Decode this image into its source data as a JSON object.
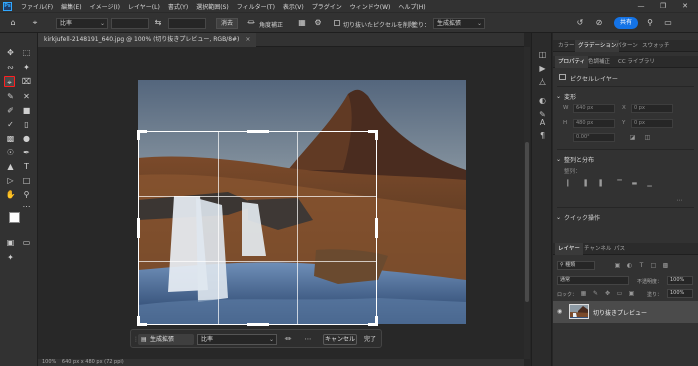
{
  "app": {
    "logo": "Ps"
  },
  "menubar": {
    "items": [
      "ファイル(F)",
      "編集(E)",
      "イメージ(I)",
      "レイヤー(L)",
      "書式(Y)",
      "選択範囲(S)",
      "フィルター(T)",
      "表示(V)",
      "プラグイン",
      "ウィンドウ(W)",
      "ヘルプ(H)"
    ],
    "window_controls": [
      "minimize-icon",
      "restore-icon",
      "close-icon"
    ]
  },
  "options_bar": {
    "ratio_select": "比率",
    "clear_button": "消去",
    "straighten_label": "角度補正",
    "delete_cropped_label": "切り抜いたピクセルを削除",
    "fill_label": "塗り：",
    "fill_select": "生成拡張",
    "share_button": "共有"
  },
  "document": {
    "tab_title": "kirkjufell-2148191_640.jpg @ 100% (切り抜きプレビュー, RGB/8#)",
    "tab_close": "×"
  },
  "statusbar": {
    "zoom": "100%",
    "size": "640 px x 480 px (72 ppi)"
  },
  "taskbar": {
    "generative_expand": "生成拡張",
    "ratio": "比率",
    "cancel": "キャンセル",
    "done": "完了"
  },
  "right_panel": {
    "top_tabs": [
      "カラー",
      "グラデーション",
      "パターン",
      "スウォッチ"
    ],
    "prop_tabs": [
      "プロパティ",
      "色調補正",
      "CC ライブラリ"
    ],
    "pixel_layer": "ピクセルレイヤー",
    "transform_title": "変形",
    "fields": {
      "w": "640 px",
      "h": "480 px",
      "x": "0 px",
      "y": "0 px",
      "angle": "0.00°"
    },
    "align_title": "整列と分布",
    "align_label": "整列：",
    "quick_actions": "クイック操作",
    "layers_tabs": [
      "レイヤー",
      "チャンネル",
      "パス"
    ],
    "kind_label": "種類",
    "blend_mode": "通常",
    "opacity_label": "不透明度：",
    "opacity_value": "100%",
    "lock_label": "ロック：",
    "fill_label": "塗り：",
    "fill_value": "100%",
    "layer_name": "切り抜きプレビュー"
  },
  "colors": {
    "accent": "#1473e6",
    "crop_tool_highlight": "#ff2020",
    "panel_bg": "#323232",
    "canvas_bg": "#282828"
  }
}
